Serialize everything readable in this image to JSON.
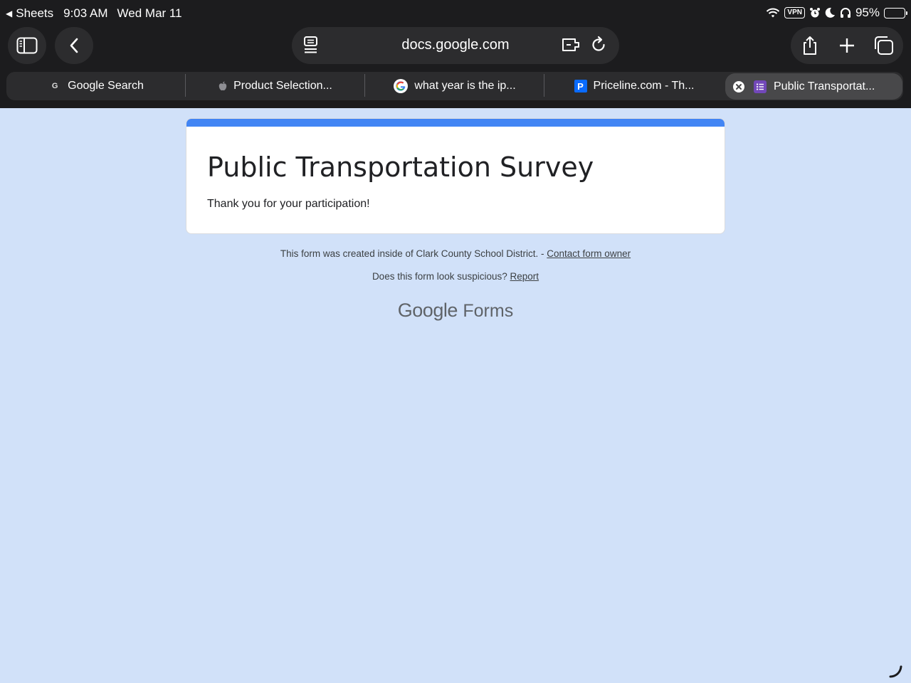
{
  "status_bar": {
    "back_app": "Sheets",
    "time": "9:03 AM",
    "date": "Wed Mar 11",
    "vpn": "VPN",
    "battery": "95%",
    "battery_level": 0.95
  },
  "browser": {
    "url": "docs.google.com",
    "tabs": [
      {
        "title": "Google Search",
        "favicon": "G"
      },
      {
        "title": "Product Selection...",
        "favicon": "apple-icon"
      },
      {
        "title": "what year is the ip...",
        "favicon": "google-icon"
      },
      {
        "title": "Priceline.com - Th...",
        "favicon": "P"
      },
      {
        "title": "Public Transportat...",
        "favicon": "forms-icon",
        "active": true
      }
    ]
  },
  "form": {
    "title": "Public Transportation Survey",
    "message": "Thank you for your participation!",
    "accent_color": "#4285f4",
    "background_color": "#d1e1f9"
  },
  "footer": {
    "created_text": "This form was created inside of Clark County School District. - ",
    "contact_link": "Contact form owner",
    "suspicious_text": "Does this form look suspicious? ",
    "report_link": "Report",
    "brand_google": "Google",
    "brand_forms": "Forms"
  }
}
